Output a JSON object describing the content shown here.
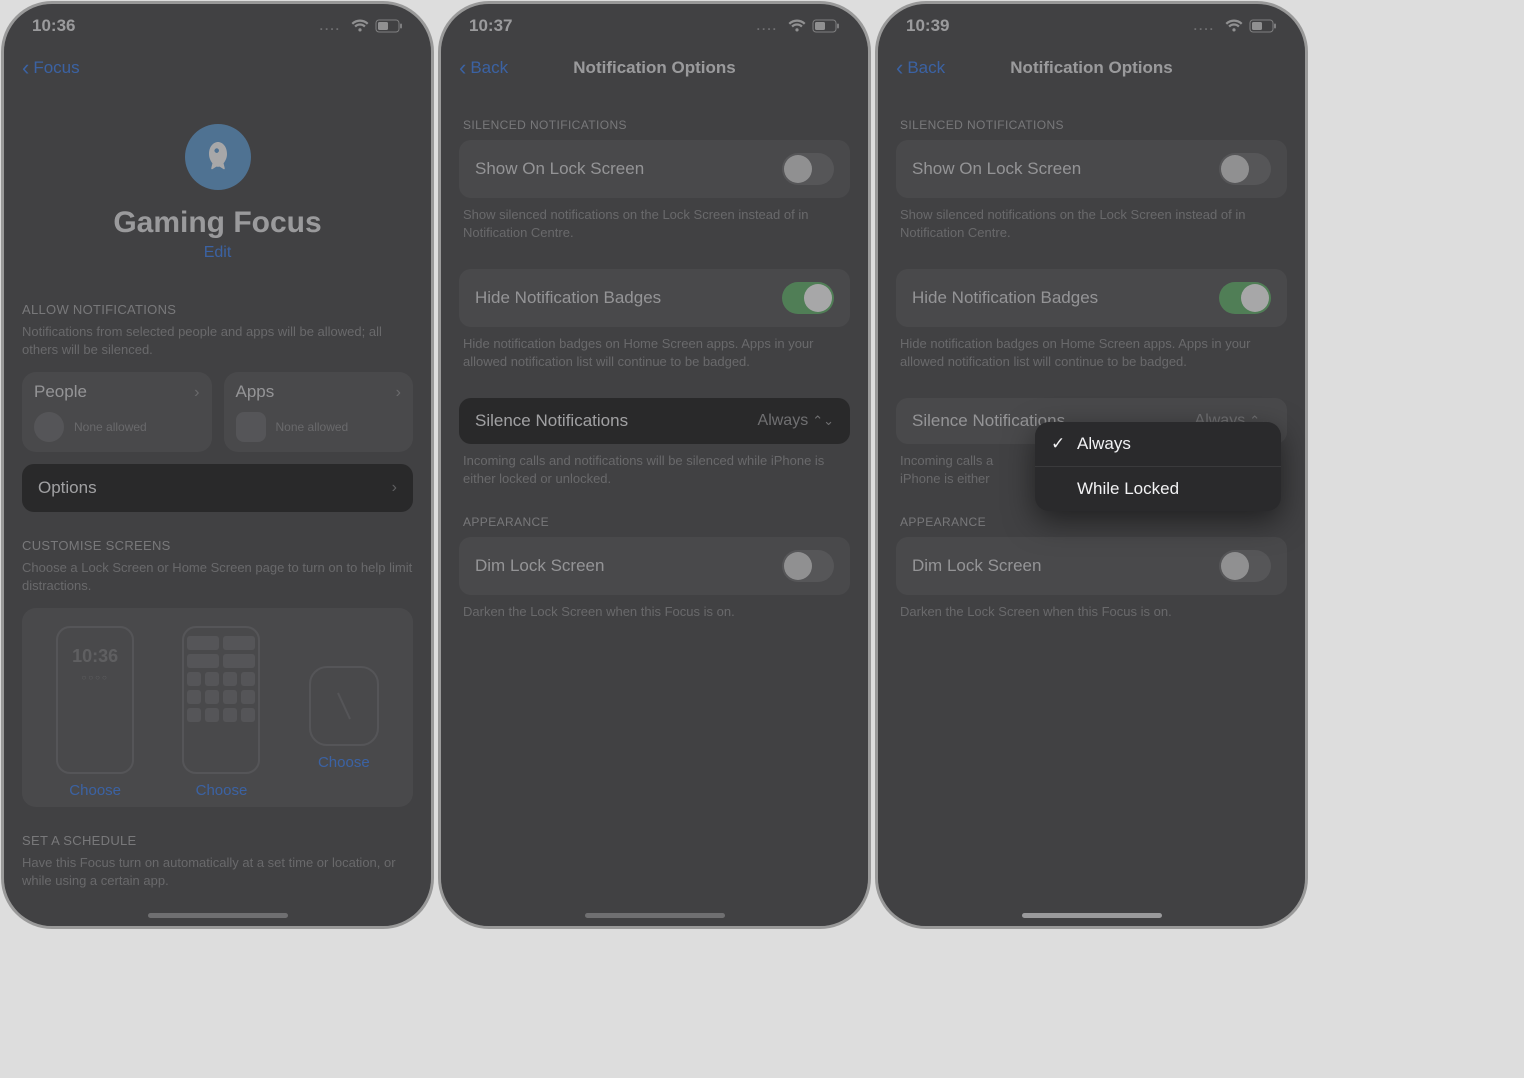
{
  "accent": "#3b82f6",
  "left": {
    "status_time": "10:36",
    "back_label": "Focus",
    "hero_title": "Gaming Focus",
    "edit_label": "Edit",
    "allow_header": "ALLOW NOTIFICATIONS",
    "allow_sub": "Notifications from selected people and apps will be allowed; all others will be silenced.",
    "people_label": "People",
    "people_value": "None allowed",
    "apps_label": "Apps",
    "apps_value": "None allowed",
    "options_label": "Options",
    "customise_header": "CUSTOMISE SCREENS",
    "customise_sub": "Choose a Lock Screen or Home Screen page to turn on to help limit distractions.",
    "choose_label": "Choose",
    "lock_preview_time": "10:36",
    "schedule_header": "SET A SCHEDULE",
    "schedule_sub": "Have this Focus turn on automatically at a set time or location, or while using a certain app."
  },
  "mid": {
    "status_time": "10:37",
    "back_label": "Back",
    "title": "Notification Options",
    "silenced_header": "SILENCED NOTIFICATIONS",
    "show_lock_label": "Show On Lock Screen",
    "show_lock_on": false,
    "show_lock_foot": "Show silenced notifications on the Lock Screen instead of in Notification Centre.",
    "hide_badges_label": "Hide Notification Badges",
    "hide_badges_on": true,
    "hide_badges_foot": "Hide notification badges on Home Screen apps. Apps in your allowed notification list will continue to be badged.",
    "silence_label": "Silence Notifications",
    "silence_value": "Always",
    "silence_foot": "Incoming calls and notifications will be silenced while iPhone is either locked or unlocked.",
    "appearance_header": "APPEARANCE",
    "dim_label": "Dim Lock Screen",
    "dim_on": false,
    "dim_foot": "Darken the Lock Screen when this Focus is on."
  },
  "right": {
    "status_time": "10:39",
    "back_label": "Back",
    "title": "Notification Options",
    "silenced_header": "SILENCED NOTIFICATIONS",
    "show_lock_label": "Show On Lock Screen",
    "show_lock_on": false,
    "show_lock_foot": "Show silenced notifications on the Lock Screen instead of in Notification Centre.",
    "hide_badges_label": "Hide Notification Badges",
    "hide_badges_on": true,
    "hide_badges_foot": "Hide notification badges on Home Screen apps. Apps in your allowed notification list will continue to be badged.",
    "silence_label": "Silence Notifications",
    "silence_value": "Always",
    "silence_foot_short": "Incoming calls a\niPhone is either",
    "appearance_header": "APPEARANCE",
    "dim_label": "Dim Lock Screen",
    "dim_on": false,
    "dim_foot": "Darken the Lock Screen when this Focus is on.",
    "menu": {
      "opt1": "Always",
      "opt2": "While Locked",
      "selected": "Always"
    }
  }
}
